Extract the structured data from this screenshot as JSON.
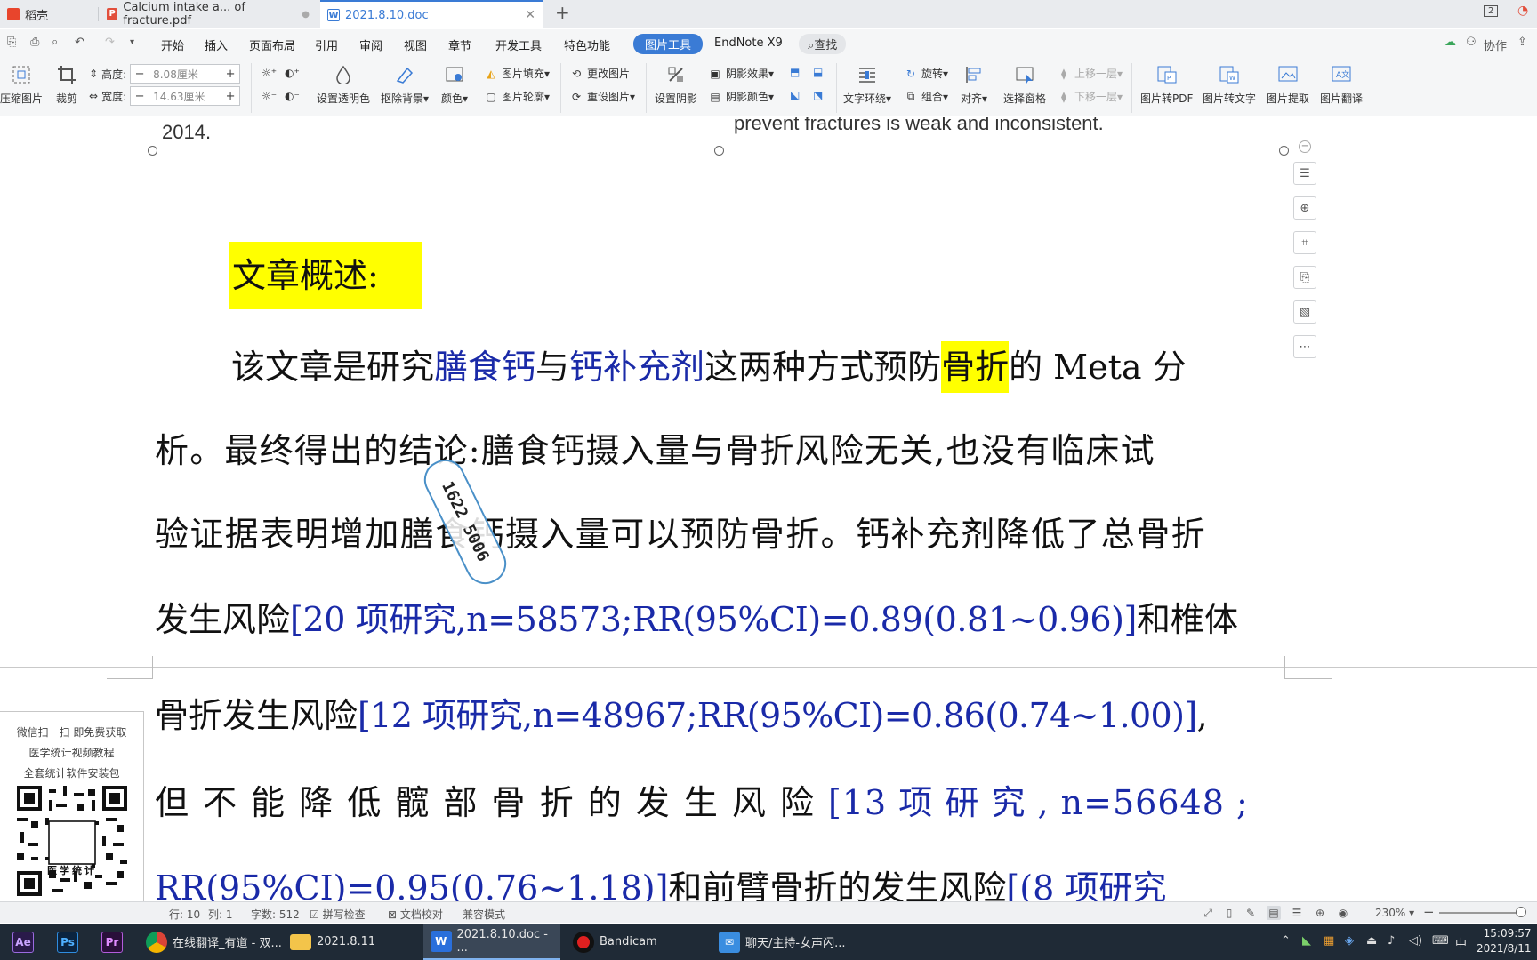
{
  "tabs": [
    {
      "label": "稻壳"
    },
    {
      "label": "Calcium intake a... of fracture.pdf"
    },
    {
      "label": "2021.8.10.doc"
    }
  ],
  "window": {
    "badge": "2"
  },
  "menu": {
    "items": [
      "开始",
      "插入",
      "页面布局",
      "引用",
      "审阅",
      "视图",
      "章节",
      "开发工具",
      "特色功能"
    ],
    "active": "图片工具",
    "endnote": "EndNote X9",
    "search": "查找",
    "collab": "协作"
  },
  "ribbon": {
    "compress": "压缩图片",
    "crop": "裁剪",
    "height_label": "高度:",
    "height_value": "8.08厘米",
    "width_label": "宽度:",
    "width_value": "14.63厘米",
    "transparent": "设置透明色",
    "remove_bg": "抠除背景",
    "color": "颜色",
    "fill": "图片填充",
    "outline": "图片轮廓",
    "change": "更改图片",
    "reset": "重设图片",
    "shadow": "设置阴影",
    "shadow_effect": "阴影效果",
    "shadow_color": "阴影颜色",
    "wrap": "文字环绕",
    "rotate": "旋转",
    "group": "组合",
    "align": "对齐",
    "select_pane": "选择窗格",
    "up": "上移一层",
    "down": "下移一层",
    "to_pdf": "图片转PDF",
    "to_text": "图片转文字",
    "extract": "图片提取",
    "translate": "图片翻译"
  },
  "document": {
    "eng_left": "2014.",
    "eng_right": "prevent fractures is weak and inconsistent.",
    "heading": "文章概述:",
    "lines": {
      "l1a": "该文章是研究",
      "l1b": "膳食钙",
      "l1c": "与",
      "l1d": "钙补充剂",
      "l1e": "这两种方式预防",
      "l1f": "骨折",
      "l1g": "的 Meta 分",
      "l2": "析。最终得出的结论:膳食钙摄入量与骨折风险无关,也没有临床试",
      "l3": "验证据表明增加膳食钙摄入量可以预防骨折。钙补充剂降低了总骨折",
      "l4a": "发生风险",
      "l4b": "[20 项研究,n=58573;RR(95%CI)=0.89(0.81~0.96)]",
      "l4c": "和椎体",
      "l5a": "骨折发生风险",
      "l5b": "[12 项研究,n=48967;RR(95%CI)=0.86(0.74~1.00)]",
      "l5c": ",",
      "l6a": "但 不 能 降 低 髋 部 骨 折 的 发 生 风 险",
      "l6b": "[13 项 研 究 , n=56648 ;",
      "l7a": "RR(95%CI)=0.95(0.76~1.18)]",
      "l7b": "和前臂骨折的发生风险",
      "l7c": "[(8 项研究"
    },
    "stamp": "1622 5006"
  },
  "qr_panel": {
    "line1": "微信扫一扫 即免费获取",
    "line2": "医学统计视频教程",
    "line3": "全套统计软件安装包",
    "qr_label": "医学统计"
  },
  "status": {
    "row": "行: 10",
    "col": "列: 1",
    "words": "字数: 512",
    "spell": "拼写检查",
    "proof": "文档校对",
    "compat": "兼容模式",
    "zoom": "230%"
  },
  "taskbar": {
    "apps": [
      "Ae",
      "Ps",
      "Pr"
    ],
    "chrome": "在线翻译_有道 - 双...",
    "folder": "2021.8.11",
    "wps": "2021.8.10.doc - ...",
    "bandicam": "Bandicam",
    "chat": "聊天/主持-女声闪...",
    "ime": "中",
    "time": "15:09:57",
    "date": "2021/8/11"
  }
}
